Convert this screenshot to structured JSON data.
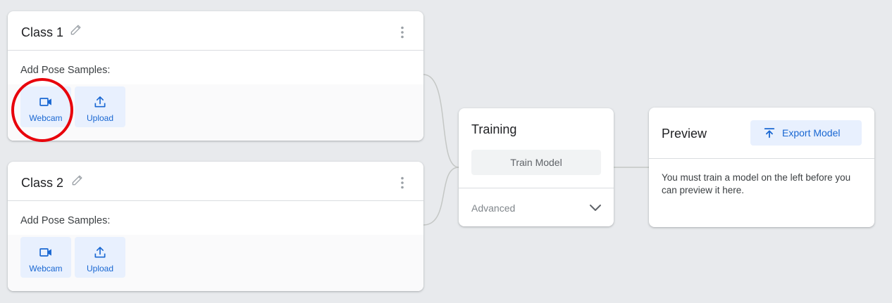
{
  "classes": [
    {
      "title": "Class 1",
      "samples_label": "Add Pose Samples:",
      "webcam_label": "Webcam",
      "upload_label": "Upload"
    },
    {
      "title": "Class 2",
      "samples_label": "Add Pose Samples:",
      "webcam_label": "Webcam",
      "upload_label": "Upload"
    }
  ],
  "training": {
    "title": "Training",
    "train_button_label": "Train Model",
    "advanced_label": "Advanced"
  },
  "preview": {
    "title": "Preview",
    "export_button_label": "Export Model",
    "message": "You must train a model on the left before you can preview it here."
  },
  "colors": {
    "accent_blue": "#1967d2",
    "button_blue_bg": "#e8f0fe",
    "highlight_red": "#e8000b",
    "background": "#e8eaed"
  },
  "icons": {
    "edit": "pencil-icon",
    "menu": "more-vert-icon",
    "webcam": "videocam-icon",
    "upload": "upload-icon",
    "advanced": "chevron-down-icon",
    "export": "export-icon"
  }
}
